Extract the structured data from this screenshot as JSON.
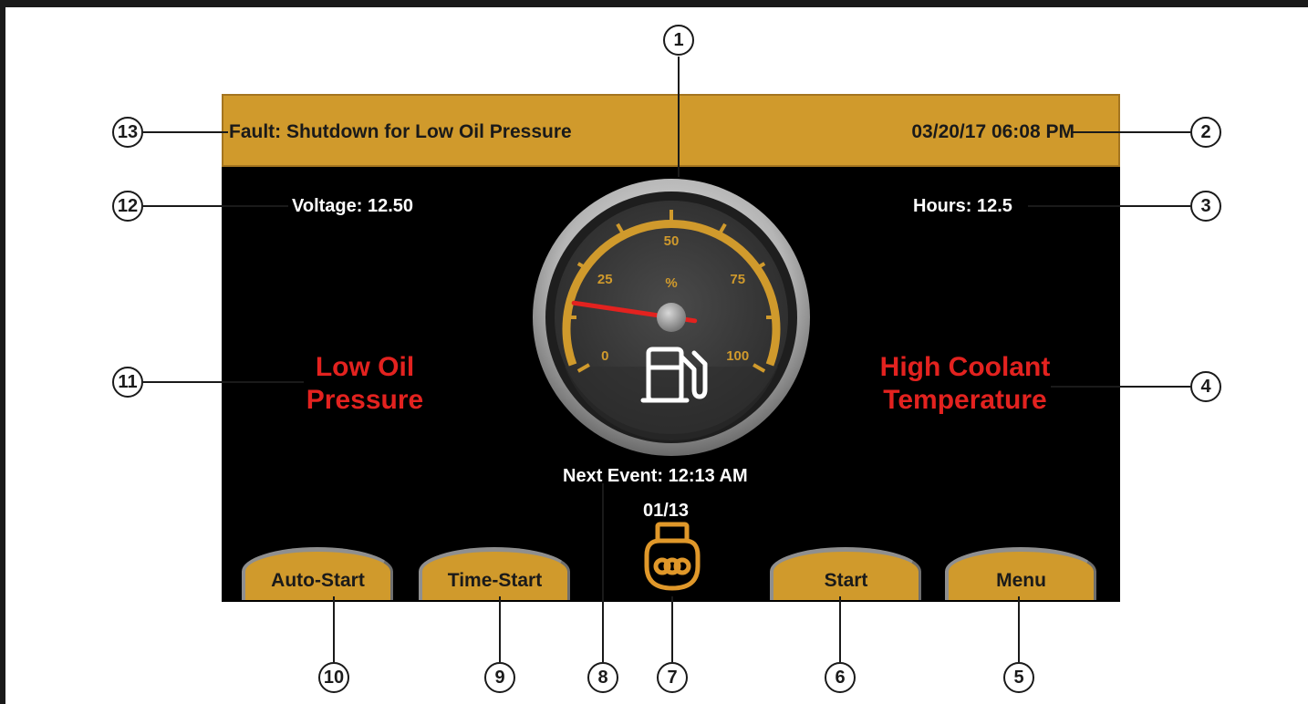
{
  "status_bar": {
    "fault": "Fault: Shutdown for Low Oil Pressure",
    "datetime": "03/20/17 06:08 PM"
  },
  "readouts": {
    "voltage": "Voltage: 12.50",
    "hours": "Hours: 12.5"
  },
  "alarms": {
    "left_line1": "Low Oil",
    "left_line2": "Pressure",
    "right_line1": "High Coolant",
    "right_line2": "Temperature"
  },
  "gauge": {
    "unit": "%",
    "ticks": [
      "0",
      "25",
      "50",
      "75",
      "100"
    ],
    "level_percent": 0.16,
    "icon": "fuel-pump-icon"
  },
  "next_event": "Next Event: 12:13 AM",
  "page_counter": "01/13",
  "glow_plug_icon": "glow-plug-icon",
  "buttons": {
    "auto_start": "Auto-Start",
    "time_start": "Time-Start",
    "start": "Start",
    "menu": "Menu"
  },
  "callouts": [
    "1",
    "2",
    "3",
    "4",
    "5",
    "6",
    "7",
    "8",
    "9",
    "10",
    "11",
    "12",
    "13"
  ],
  "colors": {
    "accent": "#d09a2c",
    "alarm": "#e3221f",
    "screen_bg": "#000000"
  }
}
